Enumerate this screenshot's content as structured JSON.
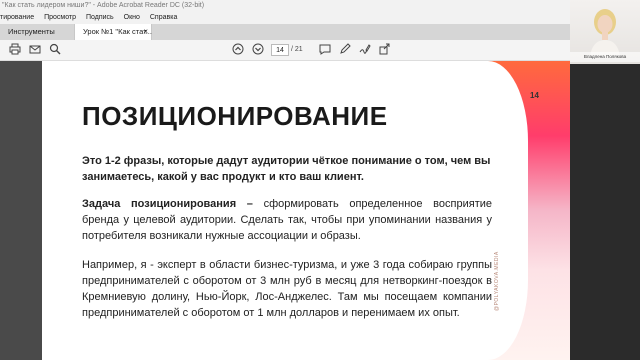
{
  "window": {
    "title": "\"Как стать лидером ниши?\" - Adobe Acrobat Reader DC (32-bit)"
  },
  "menu": [
    "тирование",
    "Просмотр",
    "Подпись",
    "Окно",
    "Справка"
  ],
  "tabs": {
    "tools": "Инструменты",
    "document": "Урок №1 \"Как стат...",
    "close_glyph": "×"
  },
  "toolbar": {
    "current_page": "14",
    "total_pages": "/ 21",
    "icons": [
      "print-icon",
      "mail-icon",
      "search-icon",
      "page-up-icon",
      "page-down-icon",
      "comment-icon",
      "pen-icon",
      "sign-icon",
      "share-icon"
    ]
  },
  "slide": {
    "page_number": "14",
    "heading": "ПОЗИЦИОНИРОВАНИЕ",
    "intro": "Это 1-2 фразы, которые дадут аудитории чёткое понимание о том, чем вы занимаетесь, какой у вас продукт и кто ваш клиент.",
    "task_label": "Задача позиционирования –",
    "task_text": " сформировать определенное восприятие бренда у целевой аудитории. Сделать так, чтобы при упоминании названия у потребителя возникали нужные ассоциации и образы.",
    "example": "Например, я - эксперт в области бизнес-туризма, и уже 3 года собираю группы предпринимателей с оборотом от 3 млн руб в месяц для нетворкинг-поездок в Кремниевую долину, Нью-Йорк, Лос-Анджелес. Там мы посещаем компании предпринимателей с оборотом от 1 млн долларов и перенимаем их опыт.",
    "watermark": "@POLYAKOVA.MEDIA"
  },
  "webcam": {
    "name": "Владлена Полякова"
  }
}
